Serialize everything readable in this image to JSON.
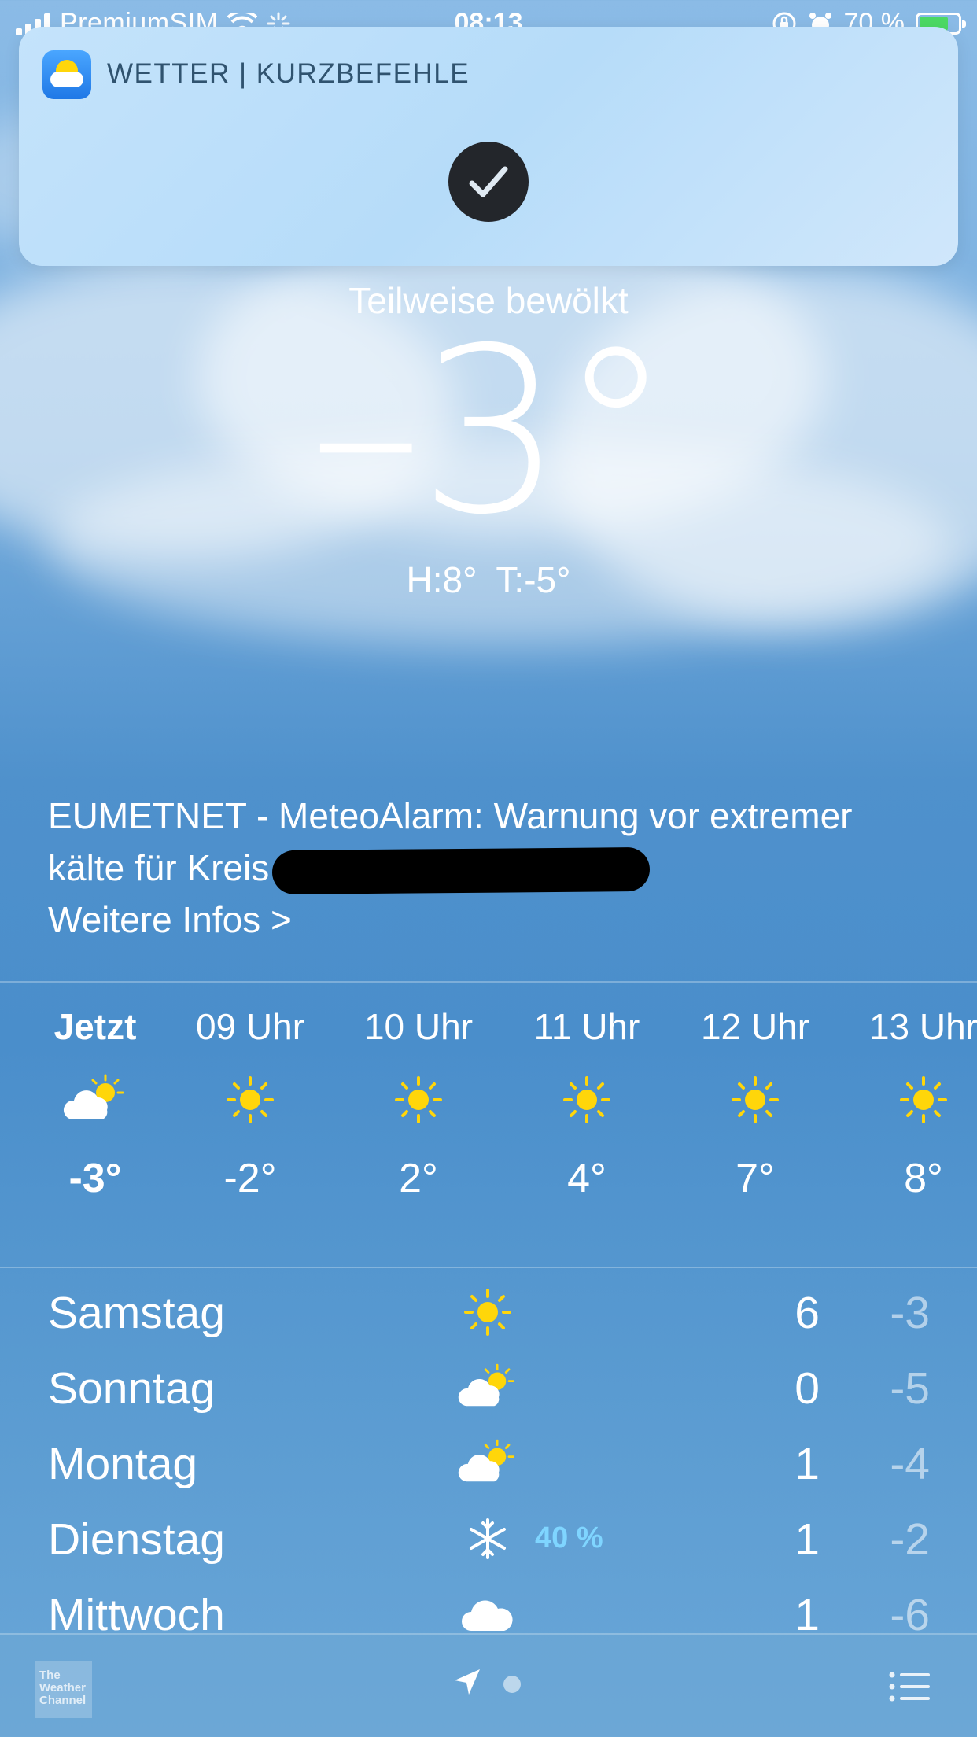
{
  "status_bar": {
    "carrier": "PremiumSIM",
    "time": "08:13",
    "battery_text": "70 %",
    "battery_level": 0.7,
    "battery_color": "#4cd964"
  },
  "notification": {
    "app_icon": "weather-app-icon",
    "title": "WETTER | KURZBEFEHLE",
    "status_icon": "checkmark-icon"
  },
  "current": {
    "condition": "Teilweise bewölkt",
    "temperature": "–3°",
    "high_low": "H:8°  T:-5°"
  },
  "alert": {
    "text": "EUMETNET - MeteoAlarm: Warnung vor extremer kälte für Kreis",
    "more_label": "Weitere Infos >"
  },
  "hourly": [
    {
      "time": "Jetzt",
      "icon": "partly-cloudy-icon",
      "temp": "-3°"
    },
    {
      "time": "09 Uhr",
      "icon": "sun-icon",
      "temp": "-2°"
    },
    {
      "time": "10 Uhr",
      "icon": "sun-icon",
      "temp": "2°"
    },
    {
      "time": "11 Uhr",
      "icon": "sun-icon",
      "temp": "4°"
    },
    {
      "time": "12 Uhr",
      "icon": "sun-icon",
      "temp": "7°"
    },
    {
      "time": "13 Uhr",
      "icon": "sun-icon",
      "temp": "8°"
    }
  ],
  "daily": [
    {
      "day": "Samstag",
      "icon": "sun-icon",
      "precip": "",
      "high": "6",
      "low": "-3"
    },
    {
      "day": "Sonntag",
      "icon": "partly-cloudy-icon",
      "precip": "",
      "high": "0",
      "low": "-5"
    },
    {
      "day": "Montag",
      "icon": "partly-cloudy-icon",
      "precip": "",
      "high": "1",
      "low": "-4"
    },
    {
      "day": "Dienstag",
      "icon": "snowflake-icon",
      "precip": "40 %",
      "high": "1",
      "low": "-2"
    },
    {
      "day": "Mittwoch",
      "icon": "cloud-icon",
      "precip": "",
      "high": "1",
      "low": "-6"
    }
  ],
  "toolbar": {
    "logo_text": "The Weather Channel",
    "location_icon": "location-arrow-icon",
    "list_icon": "list-icon"
  },
  "colors": {
    "sun": "#ffd60a",
    "precip": "#7fd5ff",
    "banner": "#c4e3fb"
  }
}
